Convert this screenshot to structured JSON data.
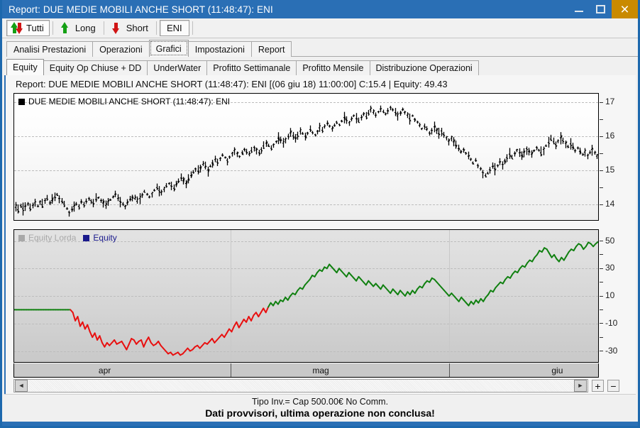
{
  "window": {
    "title": "Report: DUE MEDIE MOBILI ANCHE SHORT (11:48:47): ENI",
    "minimize_label": "",
    "maximize_label": "",
    "close_label": "×",
    "accent_color": "#2a6fb5",
    "close_color": "#c98a00"
  },
  "toolbar": {
    "items": [
      {
        "label": "Tutti",
        "icon": "up-down-arrow-icon",
        "pressed": true
      },
      {
        "label": "Long",
        "icon": "arrow-up-green-icon",
        "pressed": false
      },
      {
        "label": "Short",
        "icon": "arrow-down-red-icon",
        "pressed": false
      }
    ],
    "symbol_button": "ENI"
  },
  "main_tabs": [
    {
      "label": "Analisi Prestazioni",
      "active": false
    },
    {
      "label": "Operazioni",
      "active": false
    },
    {
      "label": "Grafici",
      "active": true
    },
    {
      "label": "Impostazioni",
      "active": false
    },
    {
      "label": "Report",
      "active": false
    }
  ],
  "sub_tabs": [
    {
      "label": "Equity",
      "active": true
    },
    {
      "label": "Equity Op Chiuse + DD",
      "active": false
    },
    {
      "label": "UnderWater",
      "active": false
    },
    {
      "label": "Profitto Settimanale",
      "active": false
    },
    {
      "label": "Profitto Mensile",
      "active": false
    },
    {
      "label": "Distribuzione Operazioni",
      "active": false
    }
  ],
  "report_header": "Report: DUE MEDIE MOBILI ANCHE SHORT (11:48:47): ENI  [(06 giu 18) 11:00:00]  C:15.4   |   Equity: 49.43",
  "price_legend": {
    "label": "DUE MEDIE MOBILI ANCHE SHORT (11:48:47): ENI",
    "color": "#000000"
  },
  "equity_legend": [
    {
      "label": "Equity Lorda",
      "color": "#a8a8a8",
      "text_color": "#a8a8a8"
    },
    {
      "label": "Equity",
      "color": "#1a1a8c",
      "text_color": "#1a1a8c"
    }
  ],
  "scrollbar": {
    "left_arrow": "◄",
    "right_arrow": "►",
    "zoom_in": "+",
    "zoom_out": "−"
  },
  "statusbar": {
    "line1": "Tipo Inv.= Cap 500.00€ No Comm.",
    "line2": "Dati provvisori, ultima operazione non conclusa!"
  },
  "chart_data": [
    {
      "id": "price",
      "type": "line",
      "title": "DUE MEDIE MOBILI ANCHE SHORT (11:48:47): ENI",
      "xlabel": "",
      "ylabel": "",
      "ylim": [
        13.55,
        17.25
      ],
      "yticks": [
        14,
        15,
        16,
        17
      ],
      "yminor": [
        13.5,
        14.5,
        15.5,
        16.5
      ],
      "grid": true,
      "series_color": "#000000",
      "xlim": [
        0,
        100
      ],
      "values": [
        13.92,
        13.85,
        13.97,
        13.88,
        13.95,
        14.02,
        13.9,
        13.98,
        14.05,
        13.95,
        14.08,
        14.0,
        14.12,
        14.18,
        14.05,
        14.12,
        14.22,
        14.3,
        14.18,
        14.1,
        14.02,
        13.88,
        13.78,
        13.86,
        13.95,
        14.02,
        13.95,
        14.08,
        14.0,
        14.1,
        14.18,
        14.12,
        14.05,
        14.15,
        14.2,
        14.12,
        14.05,
        13.98,
        14.08,
        14.15,
        14.22,
        14.3,
        14.18,
        14.1,
        14.02,
        13.95,
        14.05,
        14.15,
        14.22,
        14.18,
        14.1,
        14.18,
        14.28,
        14.38,
        14.3,
        14.22,
        14.32,
        14.42,
        14.5,
        14.42,
        14.35,
        14.45,
        14.55,
        14.62,
        14.55,
        14.48,
        14.58,
        14.68,
        14.78,
        14.7,
        14.62,
        14.72,
        14.85,
        14.95,
        15.05,
        14.98,
        15.08,
        15.18,
        15.1,
        15.02,
        15.12,
        15.22,
        15.32,
        15.25,
        15.35,
        15.45,
        15.38,
        15.3,
        15.4,
        15.5,
        15.58,
        15.5,
        15.42,
        15.52,
        15.62,
        15.55,
        15.48,
        15.58,
        15.68,
        15.6,
        15.52,
        15.62,
        15.72,
        15.8,
        15.72,
        15.65,
        15.75,
        15.85,
        15.95,
        15.88,
        15.8,
        15.9,
        16.0,
        16.1,
        16.02,
        15.95,
        16.05,
        16.15,
        16.08,
        16.0,
        16.1,
        16.2,
        16.12,
        16.05,
        16.15,
        16.25,
        16.18,
        16.28,
        16.38,
        16.3,
        16.22,
        16.32,
        16.42,
        16.35,
        16.45,
        16.55,
        16.48,
        16.4,
        16.5,
        16.6,
        16.52,
        16.45,
        16.55,
        16.65,
        16.58,
        16.68,
        16.78,
        16.7,
        16.62,
        16.72,
        16.8,
        16.72,
        16.65,
        16.75,
        16.85,
        16.78,
        16.7,
        16.6,
        16.68,
        16.78,
        16.7,
        16.62,
        16.52,
        16.6,
        16.5,
        16.42,
        16.32,
        16.22,
        16.3,
        16.2,
        16.1,
        16.18,
        16.28,
        16.18,
        16.08,
        16.16,
        16.06,
        15.96,
        15.86,
        15.94,
        15.84,
        15.74,
        15.64,
        15.54,
        15.62,
        15.52,
        15.42,
        15.32,
        15.22,
        15.3,
        15.15,
        15.05,
        14.95,
        14.85,
        14.92,
        15.02,
        15.12,
        15.05,
        15.15,
        15.25,
        15.18,
        15.28,
        15.38,
        15.48,
        15.4,
        15.5,
        15.6,
        15.52,
        15.44,
        15.54,
        15.64,
        15.56,
        15.48,
        15.58,
        15.68,
        15.6,
        15.52,
        15.62,
        15.72,
        15.82,
        15.92,
        15.84,
        15.76,
        15.86,
        15.96,
        15.88,
        15.8,
        15.7,
        15.78,
        15.68,
        15.58,
        15.66,
        15.56,
        15.46,
        15.54,
        15.44,
        15.52,
        15.62,
        15.52,
        15.42
      ]
    },
    {
      "id": "equity",
      "type": "line",
      "title": "Equity",
      "xlabel": "",
      "ylabel": "",
      "ylim": [
        -38,
        58
      ],
      "yticks": [
        -30,
        -10,
        10,
        30,
        50
      ],
      "grid": true,
      "positive_color": "#108010",
      "negative_color": "#e81010",
      "zero_level": 0,
      "xtick_labels": [
        "apr",
        "mag",
        "giu"
      ],
      "xtick_positions": [
        0.155,
        0.525,
        0.93
      ],
      "values": [
        0,
        0,
        0,
        0,
        0,
        0,
        0,
        0,
        0,
        0,
        0,
        0,
        0,
        0,
        0,
        0,
        0,
        0,
        0,
        0,
        0,
        0,
        0,
        0,
        -2,
        -8,
        -5,
        -12,
        -9,
        -14,
        -11,
        -16,
        -20,
        -17,
        -22,
        -19,
        -24,
        -27,
        -24,
        -26,
        -24,
        -22,
        -25,
        -24,
        -23,
        -26,
        -29,
        -25,
        -21,
        -22,
        -25,
        -23,
        -22,
        -27,
        -23,
        -20,
        -24,
        -26,
        -25,
        -23,
        -26,
        -28,
        -30,
        -32,
        -31,
        -33,
        -32,
        -31,
        -33,
        -32,
        -30,
        -28,
        -30,
        -29,
        -27,
        -26,
        -28,
        -26,
        -24,
        -25,
        -23,
        -21,
        -24,
        -22,
        -20,
        -18,
        -20,
        -17,
        -14,
        -16,
        -12,
        -9,
        -13,
        -10,
        -7,
        -9,
        -5,
        -8,
        -4,
        -2,
        -5,
        -2,
        1,
        -2,
        2,
        5,
        3,
        6,
        4,
        7,
        6,
        9,
        7,
        10,
        12,
        11,
        14,
        16,
        15,
        18,
        20,
        22,
        25,
        24,
        27,
        29,
        28,
        31,
        30,
        33,
        31,
        29,
        27,
        30,
        28,
        26,
        24,
        27,
        25,
        23,
        21,
        24,
        22,
        20,
        18,
        21,
        19,
        17,
        19,
        17,
        15,
        18,
        16,
        14,
        12,
        15,
        13,
        11,
        14,
        12,
        10,
        13,
        11,
        14,
        12,
        15,
        17,
        16,
        19,
        21,
        20,
        23,
        22,
        20,
        18,
        16,
        14,
        12,
        10,
        12,
        10,
        8,
        6,
        9,
        7,
        5,
        3,
        6,
        4,
        7,
        5,
        8,
        6,
        9,
        11,
        14,
        13,
        16,
        18,
        20,
        19,
        22,
        24,
        23,
        26,
        28,
        27,
        30,
        32,
        31,
        34,
        36,
        35,
        38,
        40,
        43,
        42,
        45,
        44,
        41,
        38,
        40,
        37,
        35,
        38,
        36,
        39,
        42,
        44,
        43,
        46,
        48,
        47,
        44,
        46,
        49,
        48,
        46,
        48,
        49.43
      ]
    }
  ]
}
